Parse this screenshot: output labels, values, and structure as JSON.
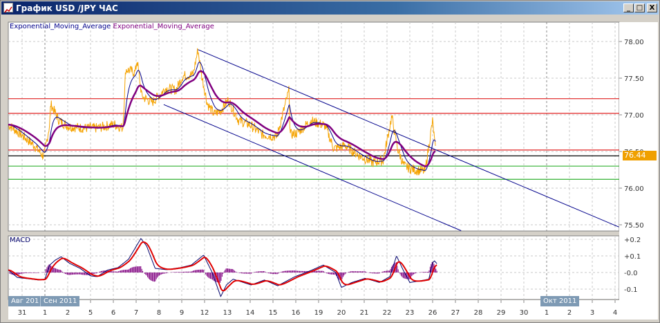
{
  "window": {
    "title": "График USD /JPY  ЧАС",
    "controls": [
      "_",
      "□",
      "X"
    ]
  },
  "indicator_labels": [
    "Exponential_Moving_Average",
    "Exponential_Moving_Average"
  ],
  "macd_label": "MACD",
  "current_price_label": "76.44",
  "month_labels": [
    "Авг 201",
    "Сен 2011",
    "Окт 2011"
  ],
  "colors": {
    "price": "#f5a300",
    "ema_fast": "#00008b",
    "ema_slow": "#800080",
    "trendlines": "#00008b",
    "resistance": "#e02020",
    "current": "#000000",
    "support": "#30b030",
    "macd": "#00006b",
    "signal": "#e00000",
    "histogram": "#800080",
    "price_tag": "#f0a000"
  },
  "chart_data": [
    {
      "type": "line",
      "title": "",
      "y_axis_ticks": [
        "78.00",
        "77.50",
        "77.00",
        "76.50",
        "76.00",
        "75.50"
      ],
      "ylim": [
        75.47,
        78.26
      ],
      "grid": true,
      "x_tick_labels": [
        "31",
        "1",
        "2",
        "5",
        "6",
        "7",
        "8",
        "9",
        "12",
        "13",
        "14",
        "15",
        "16",
        "19",
        "20",
        "21",
        "22",
        "23",
        "26",
        "27",
        "28",
        "29",
        "30",
        "1",
        "2",
        "3",
        "4"
      ],
      "trading_days": [
        "08-30",
        "08-31",
        "09-01",
        "09-02",
        "09-05",
        "09-06",
        "09-07",
        "09-08",
        "09-09",
        "09-12",
        "09-13",
        "09-14",
        "09-15",
        "09-16",
        "09-19",
        "09-20",
        "09-21",
        "09-22",
        "09-23",
        "09-26",
        "09-27",
        "09-28",
        "09-29",
        "09-30",
        "10-01",
        "10-02",
        "10-03",
        "10-04"
      ],
      "series": [
        {
          "kind": "price",
          "points": [
            [
              "08-30 09",
              76.87
            ],
            [
              "08-30 23",
              76.73
            ],
            [
              "08-31 13",
              76.58
            ],
            [
              "08-31 20",
              76.47
            ],
            [
              "08-31 23",
              76.43
            ],
            [
              "09-01 05",
              76.87
            ],
            [
              "09-01 06",
              77.15
            ],
            [
              "09-01 15",
              76.92
            ],
            [
              "09-02 01",
              76.84
            ],
            [
              "09-02 16",
              76.82
            ],
            [
              "09-05 07",
              76.82
            ],
            [
              "09-06 01",
              76.87
            ],
            [
              "09-06 10",
              76.82
            ],
            [
              "09-06 13",
              77.62
            ],
            [
              "09-06 23",
              77.58
            ],
            [
              "09-07 01",
              77.75
            ],
            [
              "09-07 06",
              77.25
            ],
            [
              "09-07 17",
              77.17
            ],
            [
              "09-08 07",
              77.36
            ],
            [
              "09-08 18",
              77.34
            ],
            [
              "09-09 01",
              77.53
            ],
            [
              "09-09 12",
              77.55
            ],
            [
              "09-09 17",
              77.89
            ],
            [
              "09-09 21",
              77.53
            ],
            [
              "09-12 03",
              77.15
            ],
            [
              "09-12 10",
              77.01
            ],
            [
              "09-12 17",
              77.06
            ],
            [
              "09-13 01",
              77.2
            ],
            [
              "09-13 12",
              76.92
            ],
            [
              "09-13 23",
              76.87
            ],
            [
              "09-14 13",
              76.73
            ],
            [
              "09-15 04",
              76.7
            ],
            [
              "09-15 17",
              77.34
            ],
            [
              "09-15 18",
              76.73
            ],
            [
              "09-16 01",
              76.75
            ],
            [
              "09-16 16",
              76.92
            ],
            [
              "09-19 07",
              76.85
            ],
            [
              "09-19 16",
              76.54
            ],
            [
              "09-20 04",
              76.58
            ],
            [
              "09-20 19",
              76.44
            ],
            [
              "09-21 09",
              76.35
            ],
            [
              "09-21 20",
              76.38
            ],
            [
              "09-22 05",
              76.98
            ],
            [
              "09-22 11",
              76.54
            ],
            [
              "09-22 18",
              76.3
            ],
            [
              "09-23 05",
              76.25
            ],
            [
              "09-23 16",
              76.23
            ],
            [
              "09-26 00",
              76.92
            ],
            [
              "09-26 03",
              76.51
            ]
          ]
        },
        {
          "kind": "ema_fast"
        },
        {
          "kind": "ema_slow"
        }
      ],
      "trendlines": [
        {
          "from": [
            "09-09 17",
            77.89
          ],
          "to": [
            "10-04 04",
            75.47
          ]
        },
        {
          "from": [
            "09-08 05",
            77.14
          ],
          "to": [
            "09-27 06",
            75.42
          ]
        }
      ],
      "horizontal_levels": [
        {
          "kind": "resistance",
          "value": 77.22
        },
        {
          "kind": "resistance",
          "value": 77.02
        },
        {
          "kind": "resistance",
          "value": 76.52
        },
        {
          "kind": "current",
          "value": 76.44
        },
        {
          "kind": "support",
          "value": 76.3
        },
        {
          "kind": "support",
          "value": 76.12
        }
      ]
    },
    {
      "type": "line",
      "title": "MACD",
      "y_axis_ticks": [
        "+0.2",
        "+0.1",
        "-0.0",
        "-0.1"
      ],
      "ylim": [
        -0.16,
        0.22
      ],
      "grid": true,
      "series": [
        {
          "kind": "macd",
          "points": [
            [
              "08-30 09",
              0.017
            ],
            [
              "08-30 19",
              -0.03
            ],
            [
              "08-31 10",
              -0.04
            ],
            [
              "08-31 17",
              -0.045
            ],
            [
              "08-31 24",
              -0.04
            ],
            [
              "09-01 05",
              0.045
            ],
            [
              "09-01 11",
              0.075
            ],
            [
              "09-01 17",
              0.095
            ],
            [
              "09-02 02",
              0.055
            ],
            [
              "09-02 13",
              0.025
            ],
            [
              "09-05 00",
              -0.02
            ],
            [
              "09-05 07",
              -0.025
            ],
            [
              "09-05 18",
              0.015
            ],
            [
              "09-06 05",
              0.03
            ],
            [
              "09-06 16",
              0.08
            ],
            [
              "09-07 05",
              0.205
            ],
            [
              "09-07 11",
              0.16
            ],
            [
              "09-07 20",
              0.025
            ],
            [
              "09-08 08",
              0.017
            ],
            [
              "09-08 23",
              0.03
            ],
            [
              "09-09 10",
              0.045
            ],
            [
              "09-09 23",
              0.105
            ],
            [
              "09-12 08",
              0.0
            ],
            [
              "09-12 17",
              -0.145
            ],
            [
              "09-12 23",
              -0.075
            ],
            [
              "09-13 06",
              -0.04
            ],
            [
              "09-14 01",
              -0.075
            ],
            [
              "09-14 15",
              -0.045
            ],
            [
              "09-15 05",
              -0.08
            ],
            [
              "09-15 23",
              -0.025
            ],
            [
              "09-16 13",
              0.005
            ],
            [
              "09-19 05",
              0.045
            ],
            [
              "09-19 18",
              0.0
            ],
            [
              "09-20 00",
              -0.09
            ],
            [
              "09-20 11",
              -0.06
            ],
            [
              "09-21 01",
              -0.035
            ],
            [
              "09-21 16",
              -0.06
            ],
            [
              "09-22 03",
              -0.025
            ],
            [
              "09-22 10",
              0.1
            ],
            [
              "09-22 17",
              0.015
            ],
            [
              "09-23 00",
              -0.06
            ],
            [
              "09-23 11",
              -0.05
            ],
            [
              "09-23 20",
              -0.04
            ],
            [
              "09-26 00",
              0.06
            ],
            [
              "09-26 02",
              0.07
            ],
            [
              "09-26 05",
              0.05
            ]
          ]
        },
        {
          "kind": "signal"
        },
        {
          "kind": "histogram"
        }
      ]
    }
  ]
}
